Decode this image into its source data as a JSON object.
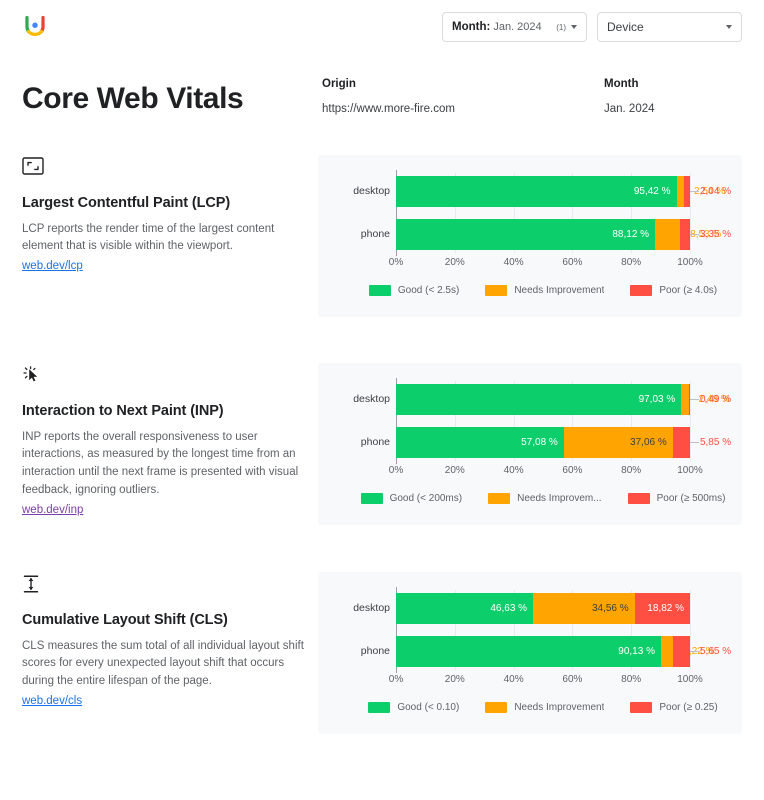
{
  "topbar": {
    "logo_icon": "crux-u-logo-icon",
    "month_filter": {
      "key": "Month:",
      "value": "Jan. 2024",
      "count": "(1)",
      "caret_icon": "chevron-down-icon"
    },
    "device_filter": {
      "label": "Device",
      "caret_icon": "chevron-down-icon"
    }
  },
  "header": {
    "title": "Core Web Vitals",
    "origin_label": "Origin",
    "origin_value": "https://www.more-fire.com",
    "month_label": "Month",
    "month_value": "Jan. 2024"
  },
  "colors": {
    "good": "#0CCE6B",
    "needs_improvement": "#FFA400",
    "poor": "#FF4E42",
    "card_bg": "#F8F9FA",
    "link": "#1A73E8",
    "link_visited": "#7B3EA8"
  },
  "axis": {
    "ticks": [
      "0%",
      "20%",
      "40%",
      "60%",
      "80%",
      "100%"
    ],
    "tick_values": [
      0,
      20,
      40,
      60,
      80,
      100
    ],
    "min": 0,
    "max": 100
  },
  "sections": [
    {
      "id": "lcp",
      "icon": "largest-contentful-paint-icon",
      "title": "Largest Contentful Paint (LCP)",
      "description": "LCP reports the render time of the largest content element that is visible within the viewport.",
      "link": "web.dev/lcp",
      "link_visited": false,
      "legend": [
        {
          "label": "Good (< 2.5s)",
          "color": "#0CCE6B"
        },
        {
          "label": "Needs Improvement",
          "color": "#FFA400"
        },
        {
          "label": "Poor (≥ 4.0s)",
          "color": "#FF4E42"
        }
      ],
      "rows": [
        {
          "label": "desktop",
          "segments": [
            {
              "name": "good",
              "value": 95.42,
              "label": "95,42 %",
              "placement": "inside-light"
            },
            {
              "name": "needs_improvement",
              "value": 2.54,
              "label": "2,54 %",
              "placement": "outside"
            },
            {
              "name": "poor",
              "value": 2.04,
              "label": "2,04 %",
              "placement": "outside"
            }
          ]
        },
        {
          "label": "phone",
          "segments": [
            {
              "name": "good",
              "value": 88.12,
              "label": "88,12 %",
              "placement": "inside-light"
            },
            {
              "name": "needs_improvement",
              "value": 8.53,
              "label": "8,53 %",
              "placement": "outside"
            },
            {
              "name": "poor",
              "value": 3.35,
              "label": "3,35 %",
              "placement": "outside"
            }
          ]
        }
      ]
    },
    {
      "id": "inp",
      "icon": "interaction-to-next-paint-icon",
      "title": "Interaction to Next Paint (INP)",
      "description": "INP reports the overall responsiveness to user interactions, as measured by the longest time from an interaction until the next frame is presented with visual feedback, ignoring outliers.",
      "link": "web.dev/inp",
      "link_visited": true,
      "legend": [
        {
          "label": "Good (< 200ms)",
          "color": "#0CCE6B"
        },
        {
          "label": "Needs Improvem...",
          "color": "#FFA400"
        },
        {
          "label": "Poor (≥ 500ms)",
          "color": "#FF4E42"
        }
      ],
      "rows": [
        {
          "label": "desktop",
          "segments": [
            {
              "name": "good",
              "value": 97.03,
              "label": "97,03 %",
              "placement": "inside-light"
            },
            {
              "name": "needs_improvement",
              "value": 2.48,
              "label": "2,48 %",
              "placement": "outside"
            },
            {
              "name": "poor",
              "value": 0.49,
              "label": "0,49 %",
              "placement": "outside"
            }
          ]
        },
        {
          "label": "phone",
          "segments": [
            {
              "name": "good",
              "value": 57.08,
              "label": "57,08 %",
              "placement": "inside-light"
            },
            {
              "name": "needs_improvement",
              "value": 37.06,
              "label": "37,06 %",
              "placement": "inside-dark"
            },
            {
              "name": "poor",
              "value": 5.85,
              "label": "5,85 %",
              "placement": "outside"
            }
          ]
        }
      ]
    },
    {
      "id": "cls",
      "icon": "cumulative-layout-shift-icon",
      "title": "Cumulative Layout Shift (CLS)",
      "description": "CLS measures the sum total of all individual layout shift scores for every unexpected layout shift that occurs during the entire lifespan of the page.",
      "link": "web.dev/cls",
      "link_visited": false,
      "legend": [
        {
          "label": "Good (< 0.10)",
          "color": "#0CCE6B"
        },
        {
          "label": "Needs Improvement",
          "color": "#FFA400"
        },
        {
          "label": "Poor (≥ 0.25)",
          "color": "#FF4E42"
        }
      ],
      "rows": [
        {
          "label": "desktop",
          "segments": [
            {
              "name": "good",
              "value": 46.63,
              "label": "46,63 %",
              "placement": "inside-light"
            },
            {
              "name": "needs_improvement",
              "value": 34.56,
              "label": "34,56 %",
              "placement": "inside-dark"
            },
            {
              "name": "poor",
              "value": 18.82,
              "label": "18,82 %",
              "placement": "inside-light"
            }
          ]
        },
        {
          "label": "phone",
          "segments": [
            {
              "name": "good",
              "value": 90.13,
              "label": "90,13 %",
              "placement": "inside-light"
            },
            {
              "name": "needs_improvement",
              "value": 4.22,
              "label": "4,22 %",
              "placement": "outside"
            },
            {
              "name": "poor",
              "value": 5.65,
              "label": "5,65 %",
              "placement": "outside"
            }
          ]
        }
      ]
    }
  ]
}
